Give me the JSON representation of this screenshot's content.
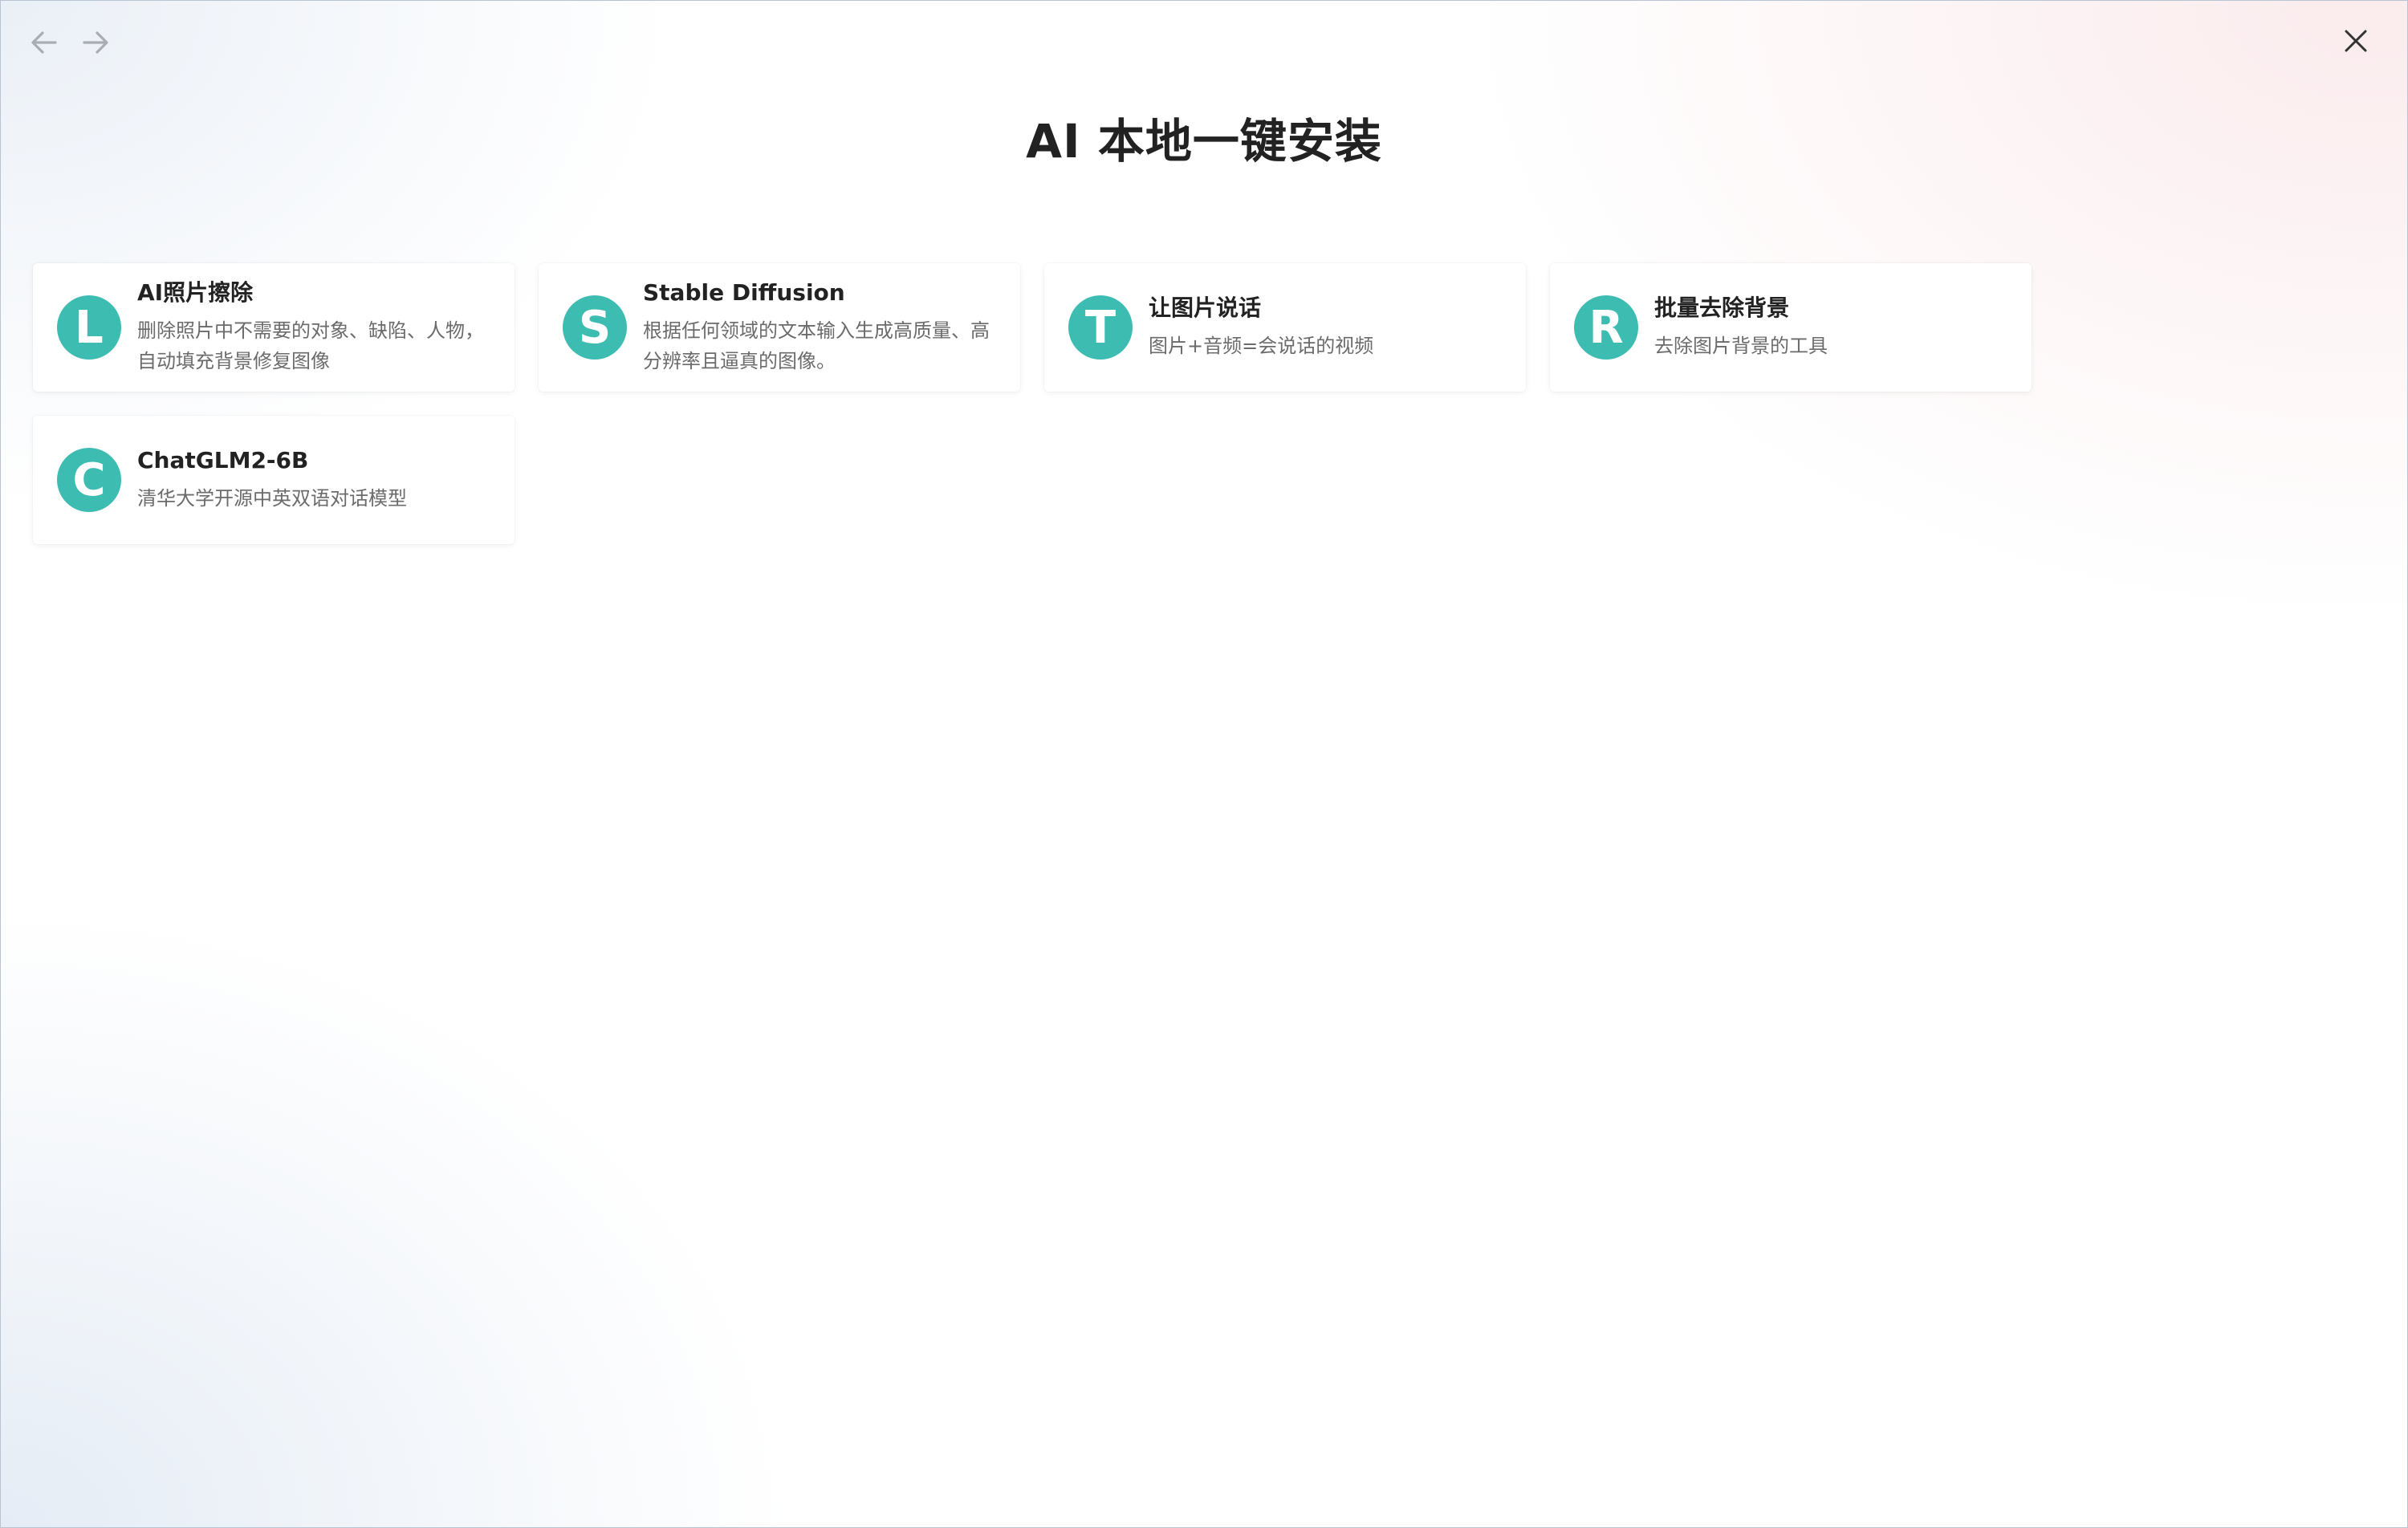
{
  "window": {
    "title": "AI 本地一键安装"
  },
  "nav": {
    "back_icon": "arrow-left-icon",
    "forward_icon": "arrow-right-icon",
    "close_icon": "close-icon"
  },
  "colors": {
    "avatar_bg": "#3dbdb1",
    "title": "#222222",
    "desc": "#6b6b6b"
  },
  "cards": [
    {
      "letter": "L",
      "title": "AI照片擦除",
      "desc": "删除照片中不需要的对象、缺陷、人物，自动填充背景修复图像"
    },
    {
      "letter": "S",
      "title": "Stable Diffusion",
      "desc": "根据任何领域的文本输入生成高质量、高分辨率且逼真的图像。"
    },
    {
      "letter": "T",
      "title": "让图片说话",
      "desc": "图片+音频=会说话的视频"
    },
    {
      "letter": "R",
      "title": "批量去除背景",
      "desc": "去除图片背景的工具"
    },
    {
      "letter": "C",
      "title": "ChatGLM2-6B",
      "desc": "清华大学开源中英双语对话模型"
    }
  ]
}
